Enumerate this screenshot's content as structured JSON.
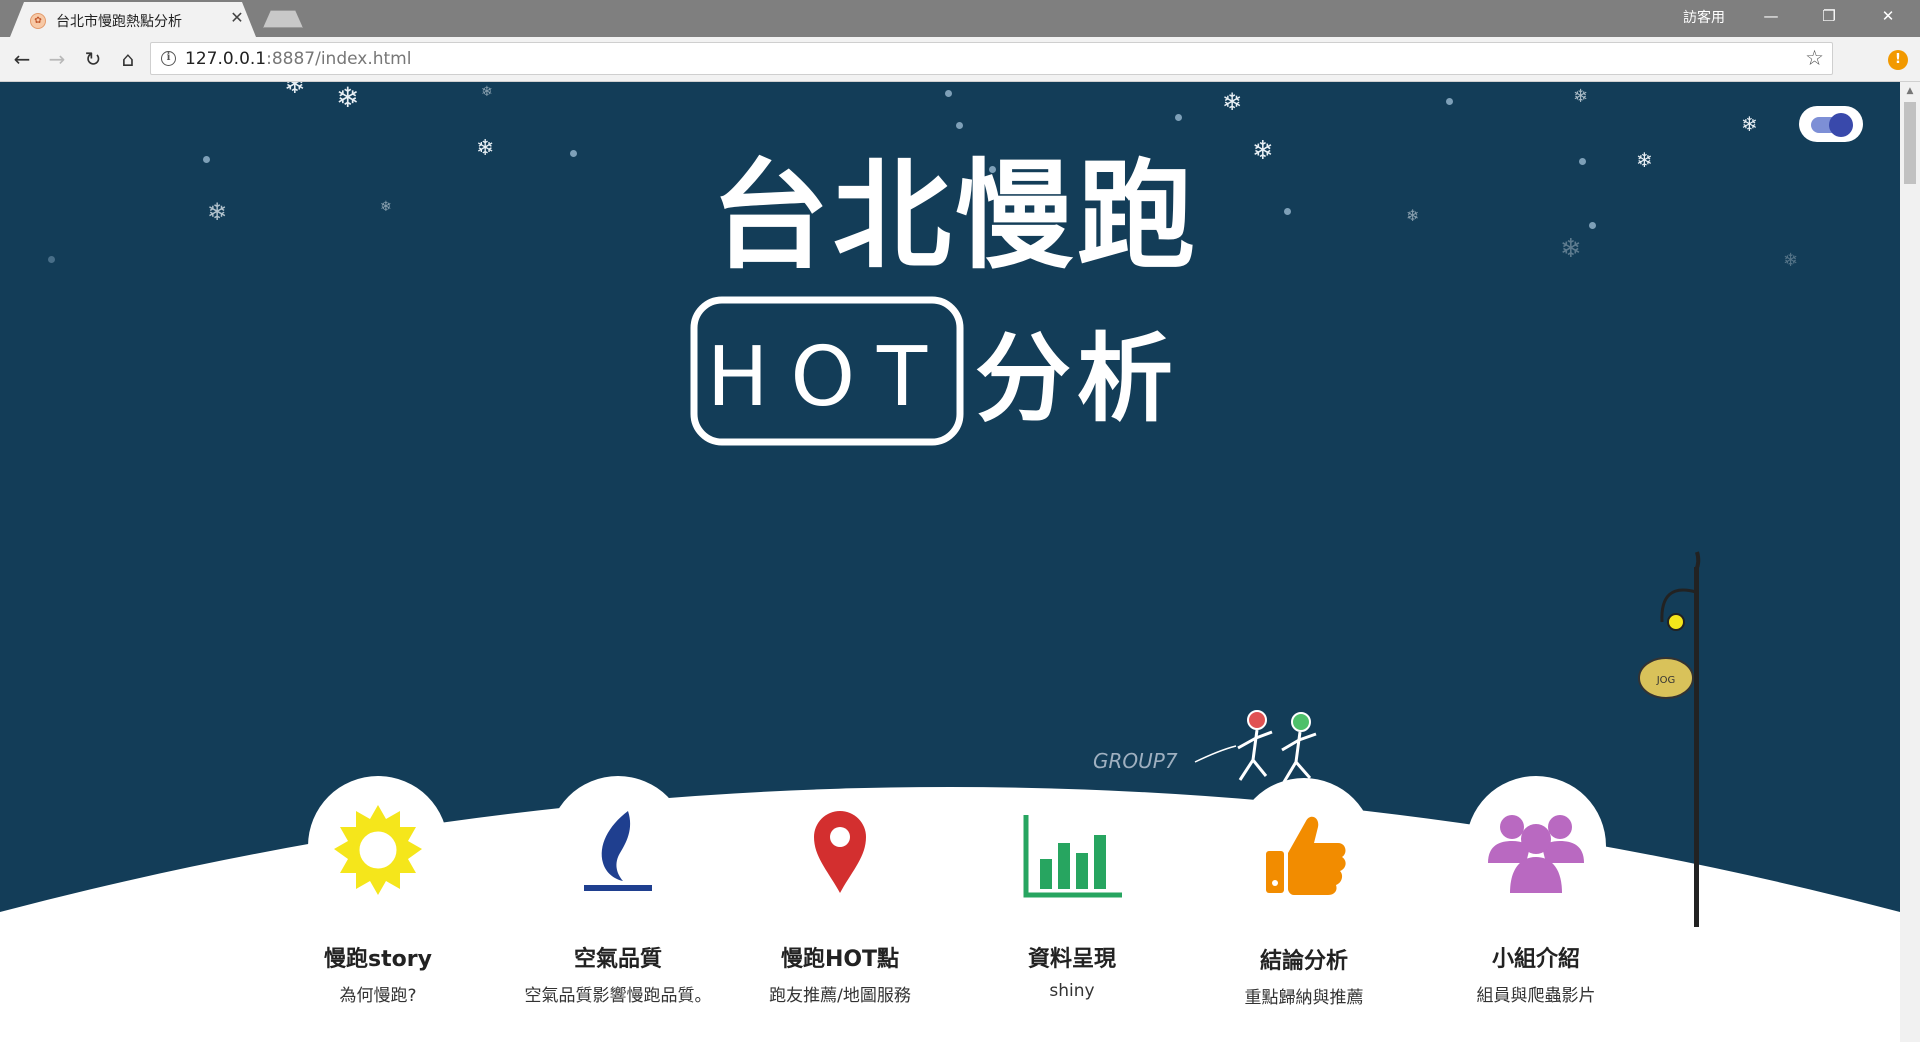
{
  "browser": {
    "tab_title": "台北市慢跑熱點分析",
    "favicon_glyph": "✿",
    "close_glyph": "✕",
    "guest_label": "訪客用",
    "url_host": "127.0.0.1",
    "url_rest": ":8887/index.html",
    "window_controls": {
      "minimize": "—",
      "restore": "❐",
      "close": "✕"
    },
    "nav": {
      "back": "←",
      "forward": "→",
      "reload": "↻",
      "home": "⌂"
    },
    "info_glyph": "i",
    "star_glyph": "☆",
    "extension_badge": "!"
  },
  "hero": {
    "title_line1": "台北慢跑",
    "title_boxed": "HOT",
    "title_line2_rest": "分析",
    "signature": "GROUP7",
    "lamp_sign": "JOG",
    "theme_toggle_on": true,
    "background_color": "#133d58"
  },
  "snow_glyph": "❄",
  "features": [
    {
      "id": "story",
      "title": "慢跑story",
      "subtitle": "為何慢跑?",
      "icon": "sun-icon",
      "color": "#f5e61b"
    },
    {
      "id": "air",
      "title": "空氣品質",
      "subtitle": "空氣品質影響慢跑品質。",
      "icon": "flame-icon",
      "color": "#1f3f8f"
    },
    {
      "id": "hot",
      "title": "慢跑HOT點",
      "subtitle": "跑友推薦/地圖服務",
      "icon": "map-pin-icon",
      "color": "#d32f2f"
    },
    {
      "id": "data",
      "title": "資料呈現",
      "subtitle": "shiny",
      "icon": "bar-chart-icon",
      "color": "#27a560"
    },
    {
      "id": "summary",
      "title": "結論分析",
      "subtitle": "重點歸納與推薦",
      "icon": "thumbs-up-icon",
      "color": "#f28c00"
    },
    {
      "id": "team",
      "title": "小組介紹",
      "subtitle": "組員與爬蟲影片",
      "icon": "group-icon",
      "color": "#b969c1"
    }
  ]
}
